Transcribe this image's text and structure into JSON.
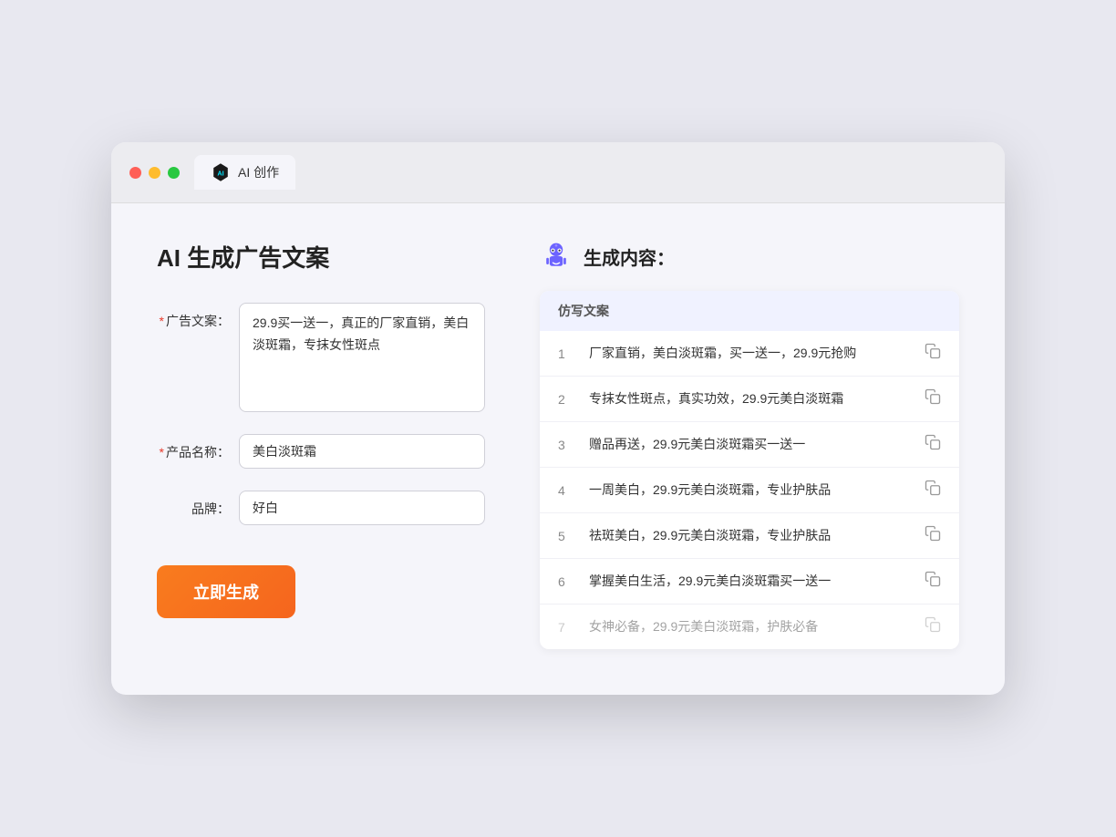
{
  "tab": {
    "label": "AI 创作"
  },
  "leftPanel": {
    "title": "AI 生成广告文案",
    "adCopyLabel": "广告文案：",
    "adCopyRequired": "*",
    "adCopyValue": "29.9买一送一，真正的厂家直销，美白淡斑霜，专抹女性斑点",
    "productNameLabel": "产品名称：",
    "productNameRequired": "*",
    "productNameValue": "美白淡斑霜",
    "brandLabel": "品牌：",
    "brandValue": "好白",
    "generateButtonLabel": "立即生成"
  },
  "rightPanel": {
    "title": "生成内容：",
    "tableHeader": "仿写文案",
    "results": [
      {
        "num": "1",
        "text": "厂家直销，美白淡斑霜，买一送一，29.9元抢购",
        "faded": false
      },
      {
        "num": "2",
        "text": "专抹女性斑点，真实功效，29.9元美白淡斑霜",
        "faded": false
      },
      {
        "num": "3",
        "text": "赠品再送，29.9元美白淡斑霜买一送一",
        "faded": false
      },
      {
        "num": "4",
        "text": "一周美白，29.9元美白淡斑霜，专业护肤品",
        "faded": false
      },
      {
        "num": "5",
        "text": "祛斑美白，29.9元美白淡斑霜，专业护肤品",
        "faded": false
      },
      {
        "num": "6",
        "text": "掌握美白生活，29.9元美白淡斑霜买一送一",
        "faded": false
      },
      {
        "num": "7",
        "text": "女神必备，29.9元美白淡斑霜，护肤必备",
        "faded": true
      }
    ]
  }
}
